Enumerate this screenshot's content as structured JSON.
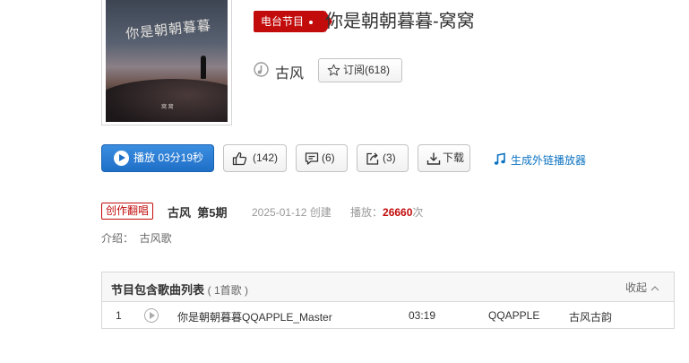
{
  "header": {
    "badge": "电台节目",
    "title": "你是朝朝暮暮-窝窝",
    "author": "古风",
    "subscribe_label": "订阅(618)"
  },
  "cover": {
    "title_text": "你是朝朝暮暮",
    "small_text": "窝 窝"
  },
  "actions": {
    "play_label": "播放 03分19秒",
    "like_count": "(142)",
    "comment_count": "(6)",
    "share_count": "(3)",
    "download_label": "下载",
    "external_player_label": "生成外链播放器"
  },
  "program": {
    "tag": "创作翻唱",
    "name": "古风",
    "episode": "第5期",
    "created": "2025-01-12 创建",
    "plays_label": "播放：",
    "plays_value": "26660",
    "plays_unit": "次",
    "intro": "介绍：  古风歌"
  },
  "songlist": {
    "title": "节目包含歌曲列表",
    "count": "( 1首歌 )",
    "collapse_label": "收起",
    "rows": [
      {
        "index": "1",
        "name": "你是朝朝暮暮QQAPPLE_Master",
        "duration": "03:19",
        "artist": "QQAPPLE",
        "album": "古风古韵"
      }
    ]
  },
  "colors": {
    "brand_red": "#c20c0c",
    "play_blue": "#1e6fc7",
    "link_blue": "#0c73c2"
  },
  "icons": [
    "play-icon",
    "like-icon",
    "comment-icon",
    "share-icon",
    "download-icon",
    "music-note-icon",
    "star-icon",
    "chevron-up-icon",
    "podcast-icon"
  ]
}
